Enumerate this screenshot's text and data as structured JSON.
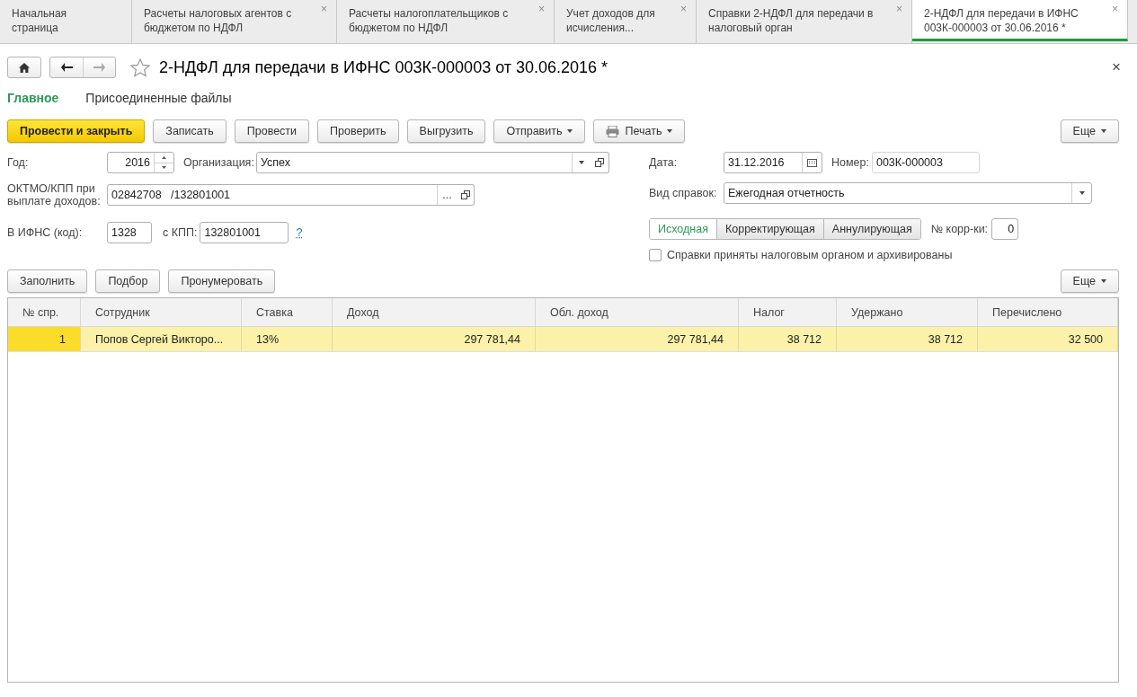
{
  "tabs": [
    {
      "label": "Начальная страница",
      "selected": false
    },
    {
      "label": "Расчеты налоговых агентов с бюджетом по НДФЛ",
      "selected": false,
      "close": "×"
    },
    {
      "label": "Расчеты налогоплательщиков с бюджетом по НДФЛ",
      "selected": false,
      "close": "×"
    },
    {
      "label": "Учет доходов для исчисления...",
      "selected": false,
      "close": "×"
    },
    {
      "label": "Справки 2-НДФЛ для передачи в налоговый орган",
      "selected": false,
      "close": "×"
    },
    {
      "label": "2-НДФЛ для передачи в ИФНС 003К-000003 от 30.06.2016 *",
      "selected": true,
      "close": "×"
    }
  ],
  "form": {
    "title": "2-НДФЛ для передачи в ИФНС 003К-000003 от 30.06.2016 *",
    "close": "×",
    "sections": [
      {
        "label": "Главное",
        "selected": true
      },
      {
        "label": "Присоединенные файлы",
        "selected": false
      }
    ],
    "toolbar": [
      {
        "label": "Провести и закрыть",
        "kind": "primary"
      },
      {
        "label": "Записать",
        "kind": "plain"
      },
      {
        "label": "Провести",
        "kind": "plain"
      },
      {
        "label": "Проверить",
        "kind": "plain"
      },
      {
        "label": "Выгрузить",
        "kind": "plain"
      },
      {
        "label": "Отправить",
        "kind": "menu"
      },
      {
        "label": "Печать",
        "kind": "print"
      }
    ],
    "more": "Еще",
    "year": {
      "label": "Год:",
      "value": "2016"
    },
    "organization": {
      "label": "Организация:",
      "value": "Успех"
    },
    "oktmo": {
      "label": "ОКТМО/КПП при выплате доходов:",
      "value": "02842708   /132801001",
      "ellipsis": "..."
    },
    "ifns": {
      "label": "В ИФНС (код):",
      "value": "1328"
    },
    "kpp": {
      "label": "с КПП:",
      "value": "132801001",
      "help": "?"
    },
    "date": {
      "label": "Дата:",
      "value": "31.12.2016"
    },
    "number": {
      "label": "Номер:",
      "value": "003К-000003"
    },
    "kind": {
      "label": "Вид справок:",
      "value": "Ежегодная отчетность"
    },
    "correction_types": [
      {
        "label": "Исходная",
        "selected": true
      },
      {
        "label": "Корректирующая",
        "selected": false
      },
      {
        "label": "Аннулирующая",
        "selected": false
      }
    ],
    "correction_number": {
      "label": "№ корр-ки:",
      "value": "0"
    },
    "archived": {
      "label": "Справки приняты налоговым органом и архивированы",
      "checked": false
    },
    "table_toolbar": [
      "Заполнить",
      "Подбор",
      "Пронумеровать"
    ],
    "table_more": "Еще",
    "table": {
      "columns": [
        {
          "label": "№ спр.",
          "kind": "number"
        },
        {
          "label": "Сотрудник",
          "kind": "text"
        },
        {
          "label": "Ставка",
          "kind": "text"
        },
        {
          "label": "Доход",
          "kind": "number"
        },
        {
          "label": "Обл. доход",
          "kind": "number"
        },
        {
          "label": "Налог",
          "kind": "number"
        },
        {
          "label": "Удержано",
          "kind": "number"
        },
        {
          "label": "Перечислено",
          "kind": "number"
        }
      ],
      "rows": [
        {
          "selected": true,
          "cells": [
            "1",
            "Попов Сергей Викторо...",
            "13%",
            "297 781,44",
            "297 781,44",
            "38 712",
            "38 712",
            "32 500"
          ]
        }
      ]
    }
  }
}
